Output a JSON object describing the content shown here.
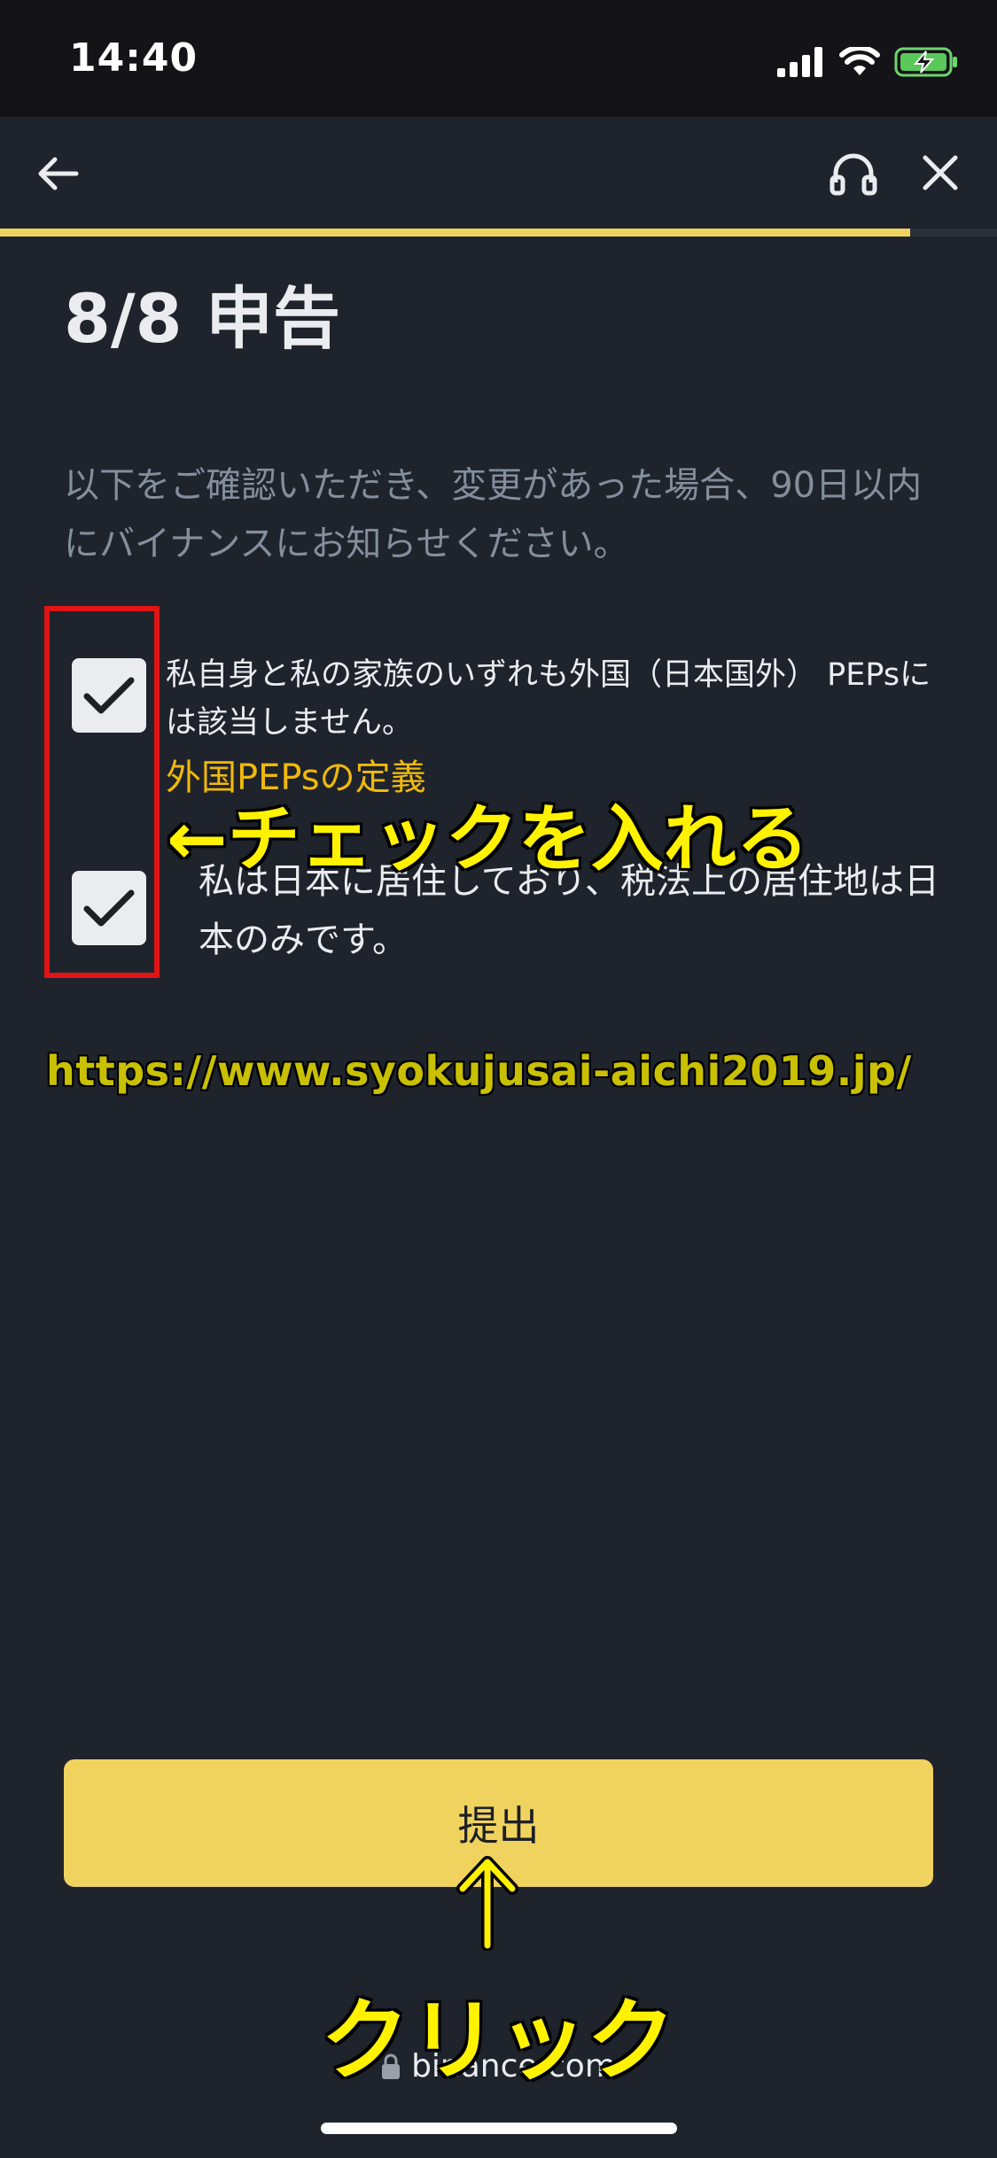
{
  "status_bar": {
    "time": "14:40",
    "icons": [
      "signal-icon",
      "wifi-icon",
      "battery-charging-icon"
    ]
  },
  "nav": {
    "back_icon": "back-arrow-icon",
    "support_icon": "headset-icon",
    "close_icon": "close-icon",
    "progress_fraction": 0.913
  },
  "page": {
    "title": "8/8 申告",
    "intro": "以下をご確認いただき、変更があった場合、90日以内にバイナンスにお知らせください。",
    "declarations": [
      {
        "checked": true,
        "text": "私自身と私の家族のいずれも外国（日本国外） PEPsには該当しません。"
      },
      {
        "checked": true,
        "text": "私は日本に居住しており、税法上の居住地は日本のみです。"
      }
    ],
    "peps_link": "外国PEPsの定義",
    "submit_label": "提出"
  },
  "annotations": {
    "check_instruction": "←チェックを入れる",
    "watermark_url": "https://www.syokujusai-aichi2019.jp/",
    "click_instruction": "クリック"
  },
  "footer": {
    "domain": "binance.com",
    "lock_icon": "lock-icon"
  },
  "colors": {
    "background": "#1f232c",
    "accent": "#f0d35e",
    "link": "#f0b90b",
    "annotation_yellow": "#fff200",
    "annotation_red": "#e01414"
  }
}
